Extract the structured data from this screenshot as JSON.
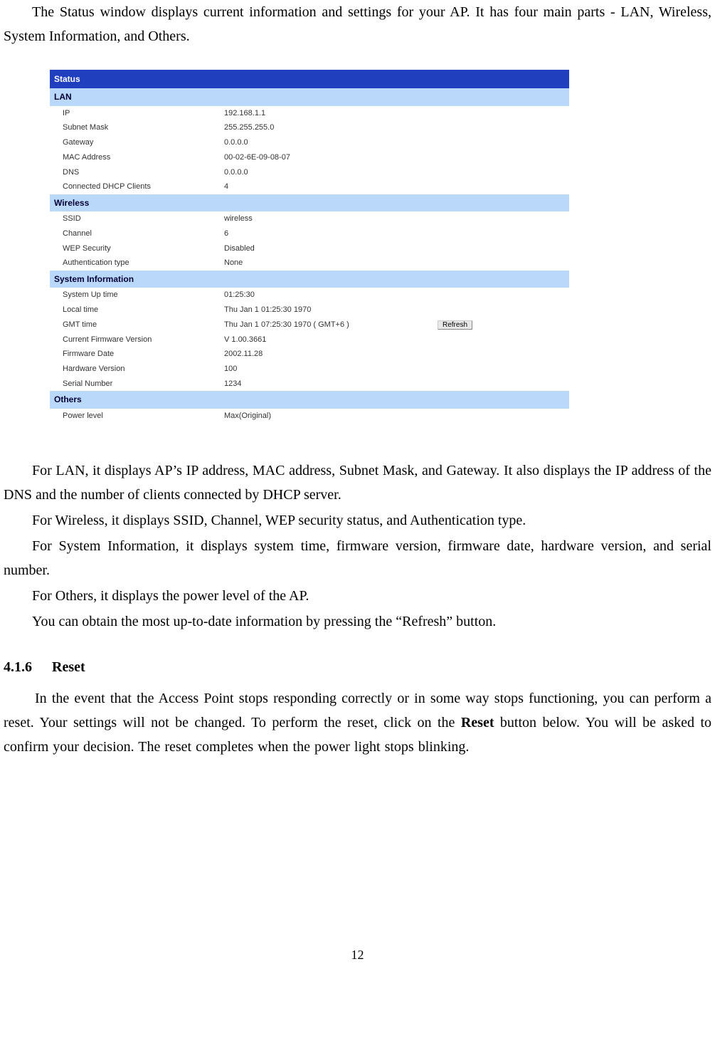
{
  "intro": "The Status window displays current information and settings for your AP. It has four main parts - LAN, Wireless, System Information, and Others.",
  "status_panel": {
    "title": "Status",
    "sections": {
      "lan": {
        "header": "LAN",
        "rows": {
          "ip": {
            "label": "IP",
            "value": "192.168.1.1"
          },
          "subnet": {
            "label": "Subnet Mask",
            "value": "255.255.255.0"
          },
          "gateway": {
            "label": "Gateway",
            "value": "0.0.0.0"
          },
          "mac": {
            "label": "MAC Address",
            "value": "00-02-6E-09-08-07"
          },
          "dns": {
            "label": "DNS",
            "value": "0.0.0.0"
          },
          "dhcp": {
            "label": "Connected DHCP Clients",
            "value": "4"
          }
        }
      },
      "wireless": {
        "header": "Wireless",
        "rows": {
          "ssid": {
            "label": "SSID",
            "value": "wireless"
          },
          "channel": {
            "label": "Channel",
            "value": "6"
          },
          "wep": {
            "label": "WEP Security",
            "value": "Disabled"
          },
          "auth": {
            "label": "Authentication type",
            "value": "None"
          }
        }
      },
      "sysinfo": {
        "header": "System Information",
        "rows": {
          "uptime": {
            "label": "System Up time",
            "value": "01:25:30"
          },
          "local": {
            "label": "Local time",
            "value": "Thu Jan 1 01:25:30 1970"
          },
          "gmt": {
            "label": "GMT time",
            "value": "Thu Jan 1 07:25:30 1970   ( GMT+6 )"
          },
          "fwver": {
            "label": "Current Firmware Version",
            "value": "V 1.00.3661"
          },
          "fwdate": {
            "label": "Firmware Date",
            "value": "2002.11.28"
          },
          "hwver": {
            "label": "Hardware Version",
            "value": "100"
          },
          "serial": {
            "label": "Serial Number",
            "value": "1234"
          }
        },
        "refresh_label": "Refresh"
      },
      "others": {
        "header": "Others",
        "rows": {
          "power": {
            "label": "Power level",
            "value": "Max(Original)"
          }
        }
      }
    }
  },
  "body": {
    "p1": "For LAN, it displays AP’s IP address, MAC address, Subnet Mask, and Gateway. It also displays the IP address of the DNS and the number of clients connected by DHCP server.",
    "p2": "For Wireless, it displays SSID, Channel, WEP security status, and Authentication type.",
    "p3": "For System Information, it displays system time, firmware version, firmware date, hardware version, and serial number.",
    "p4": "For Others, it displays the power level of the AP.",
    "p5": "You can obtain the most up-to-date information by pressing the “Refresh” button."
  },
  "section": {
    "number": "4.1.6",
    "title": "Reset",
    "para_before": "In the event that the Access Point stops responding correctly or in some way stops functioning, you can perform a reset. Your settings will not be changed. To perform the reset, click on the ",
    "bold_word": "Reset",
    "para_after": " button below. You will be asked to confirm your decision. The reset completes when the power light stops blinking."
  },
  "page_number": "12"
}
